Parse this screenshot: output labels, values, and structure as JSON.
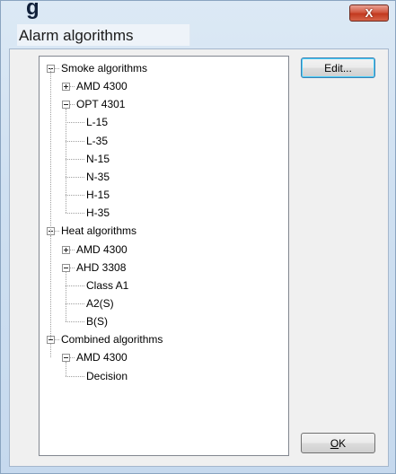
{
  "window": {
    "title_fragment": "g",
    "title": "Alarm algorithms",
    "close_symbol": "X"
  },
  "buttons": {
    "edit": "Edit...",
    "ok_mnemonic": "O",
    "ok_rest": "K"
  },
  "tree": [
    {
      "label": "Smoke algorithms",
      "level": 0,
      "toggle": "minus"
    },
    {
      "label": "AMD 4300",
      "level": 1,
      "toggle": "plus"
    },
    {
      "label": "OPT 4301",
      "level": 1,
      "toggle": "minus"
    },
    {
      "label": "L-15",
      "level": 2,
      "toggle": "none"
    },
    {
      "label": "L-35",
      "level": 2,
      "toggle": "none"
    },
    {
      "label": "N-15",
      "level": 2,
      "toggle": "none"
    },
    {
      "label": "N-35",
      "level": 2,
      "toggle": "none"
    },
    {
      "label": "H-15",
      "level": 2,
      "toggle": "none"
    },
    {
      "label": "H-35",
      "level": 2,
      "toggle": "none"
    },
    {
      "label": "Heat algorithms",
      "level": 0,
      "toggle": "minus"
    },
    {
      "label": "AMD 4300",
      "level": 1,
      "toggle": "plus"
    },
    {
      "label": "AHD 3308",
      "level": 1,
      "toggle": "minus"
    },
    {
      "label": "Class A1",
      "level": 2,
      "toggle": "none"
    },
    {
      "label": "A2(S)",
      "level": 2,
      "toggle": "none"
    },
    {
      "label": "B(S)",
      "level": 2,
      "toggle": "none"
    },
    {
      "label": "Combined algorithms",
      "level": 0,
      "toggle": "minus"
    },
    {
      "label": "AMD 4300",
      "level": 1,
      "toggle": "minus"
    },
    {
      "label": "Decision",
      "level": 2,
      "toggle": "none"
    }
  ],
  "colors": {
    "frame": "#cfe0f1",
    "close": "#c2391f",
    "focus": "#3c7fb1"
  }
}
